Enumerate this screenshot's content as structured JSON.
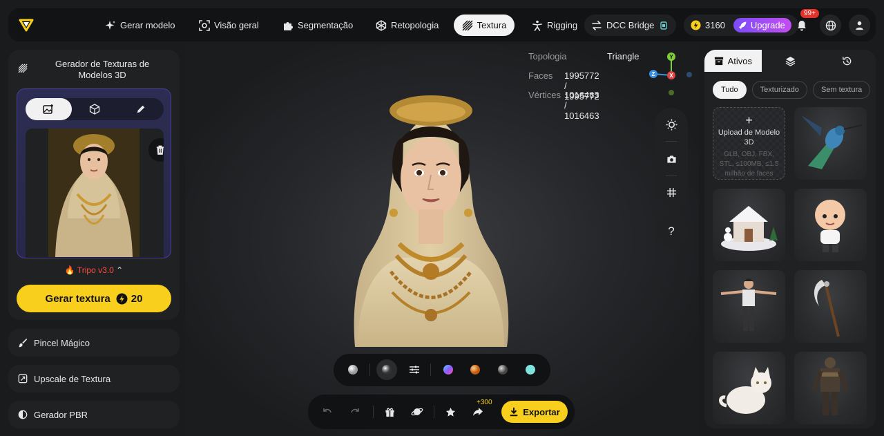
{
  "nav": {
    "items": [
      {
        "label": "Gerar modelo",
        "icon": "sparkle-icon"
      },
      {
        "label": "Visão geral",
        "icon": "focus-icon"
      },
      {
        "label": "Segmentação",
        "icon": "puzzle-icon"
      },
      {
        "label": "Retopologia",
        "icon": "mesh-icon"
      },
      {
        "label": "Textura",
        "icon": "texture-icon",
        "active": true
      },
      {
        "label": "Rigging",
        "icon": "rig-figure-icon"
      },
      {
        "label": "DCC Bridge",
        "icon": "bridge-icon"
      }
    ],
    "credits": "3160",
    "upgrade_label": "Upgrade",
    "notification_count": "99+"
  },
  "left_panel": {
    "title": "Gerador de Texturas de Modelos 3D",
    "model_version": "Tripo v3.0",
    "generate_label": "Gerar textura",
    "generate_cost": "20",
    "tools": [
      {
        "label": "Pincel Mágico",
        "icon": "brush-icon"
      },
      {
        "label": "Upscale de Textura",
        "icon": "upscale-icon"
      },
      {
        "label": "Gerador PBR",
        "icon": "half-circle-icon"
      }
    ]
  },
  "stats": {
    "topology_label": "Topologia",
    "topology_value": "Triangle",
    "faces_label": "Faces",
    "faces_value": "1995772 / 1995772",
    "vertices_label": "Vértices",
    "vertices_value": "1016463 / 1016463"
  },
  "axis": {
    "y": "Y",
    "x": "X",
    "z": "Z"
  },
  "help_label": "?",
  "bottom_bar": {
    "bonus": "+300",
    "export_label": "Exportar"
  },
  "right_panel": {
    "tabs": [
      {
        "label": "Ativos",
        "icon": "archive-icon"
      },
      {
        "label": "",
        "icon": "layers-icon"
      },
      {
        "label": "",
        "icon": "history-icon"
      }
    ],
    "filters": [
      "Tudo",
      "Texturizado",
      "Sem textura"
    ],
    "upload_title": "Upload de Modelo 3D",
    "upload_hint": "GLB, OBJ, FBX, STL, ≤100MB, ≤1.5 milhão de faces",
    "assets": [
      "hummingbird",
      "snow-house",
      "cartoon-boy",
      "t-pose-man",
      "scythe",
      "cat",
      "armored-warrior"
    ]
  },
  "colors": {
    "accent_yellow": "#f7cf1c",
    "upgrade_purple": "#7a4cf7",
    "badge_red": "#e4322b",
    "model_red": "#ff4d42"
  }
}
